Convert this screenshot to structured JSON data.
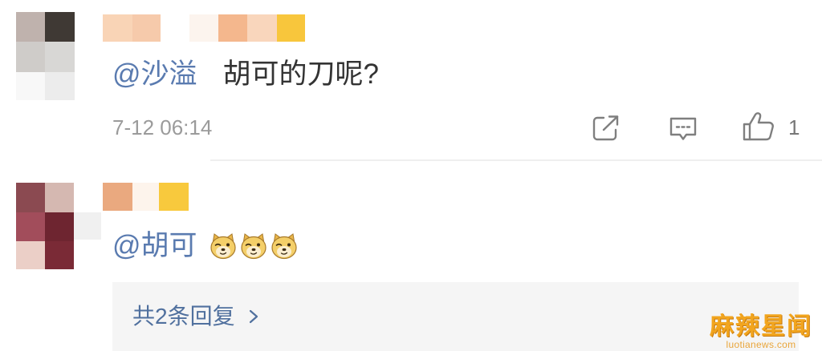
{
  "colors": {
    "mention": "#5a7bb0",
    "text": "#333333",
    "muted": "#9b9b9b",
    "icon": "#7f7f7f",
    "reply_box_bg": "#f5f5f5",
    "reply_link": "#50709e",
    "watermark": "#f2a51e"
  },
  "comments": [
    {
      "avatar": "pixelated-avatar",
      "username": "pixelated-username",
      "mention": "@沙溢",
      "text": "胡可的刀呢?",
      "time": "7-12 06:14",
      "actions": {
        "share_icon": "share-icon",
        "comment_icon": "comment-icon",
        "like_icon": "thumbs-up-icon",
        "like_count": "1"
      }
    },
    {
      "avatar": "pixelated-avatar",
      "username": "pixelated-username",
      "mention": "@胡可",
      "emojis": [
        "doge",
        "doge",
        "doge"
      ],
      "replies": {
        "label": "共2条回复",
        "chevron_icon": "chevron-right-icon"
      }
    }
  ],
  "watermark": {
    "title": "麻辣星闻",
    "site": "luotianews.com"
  }
}
